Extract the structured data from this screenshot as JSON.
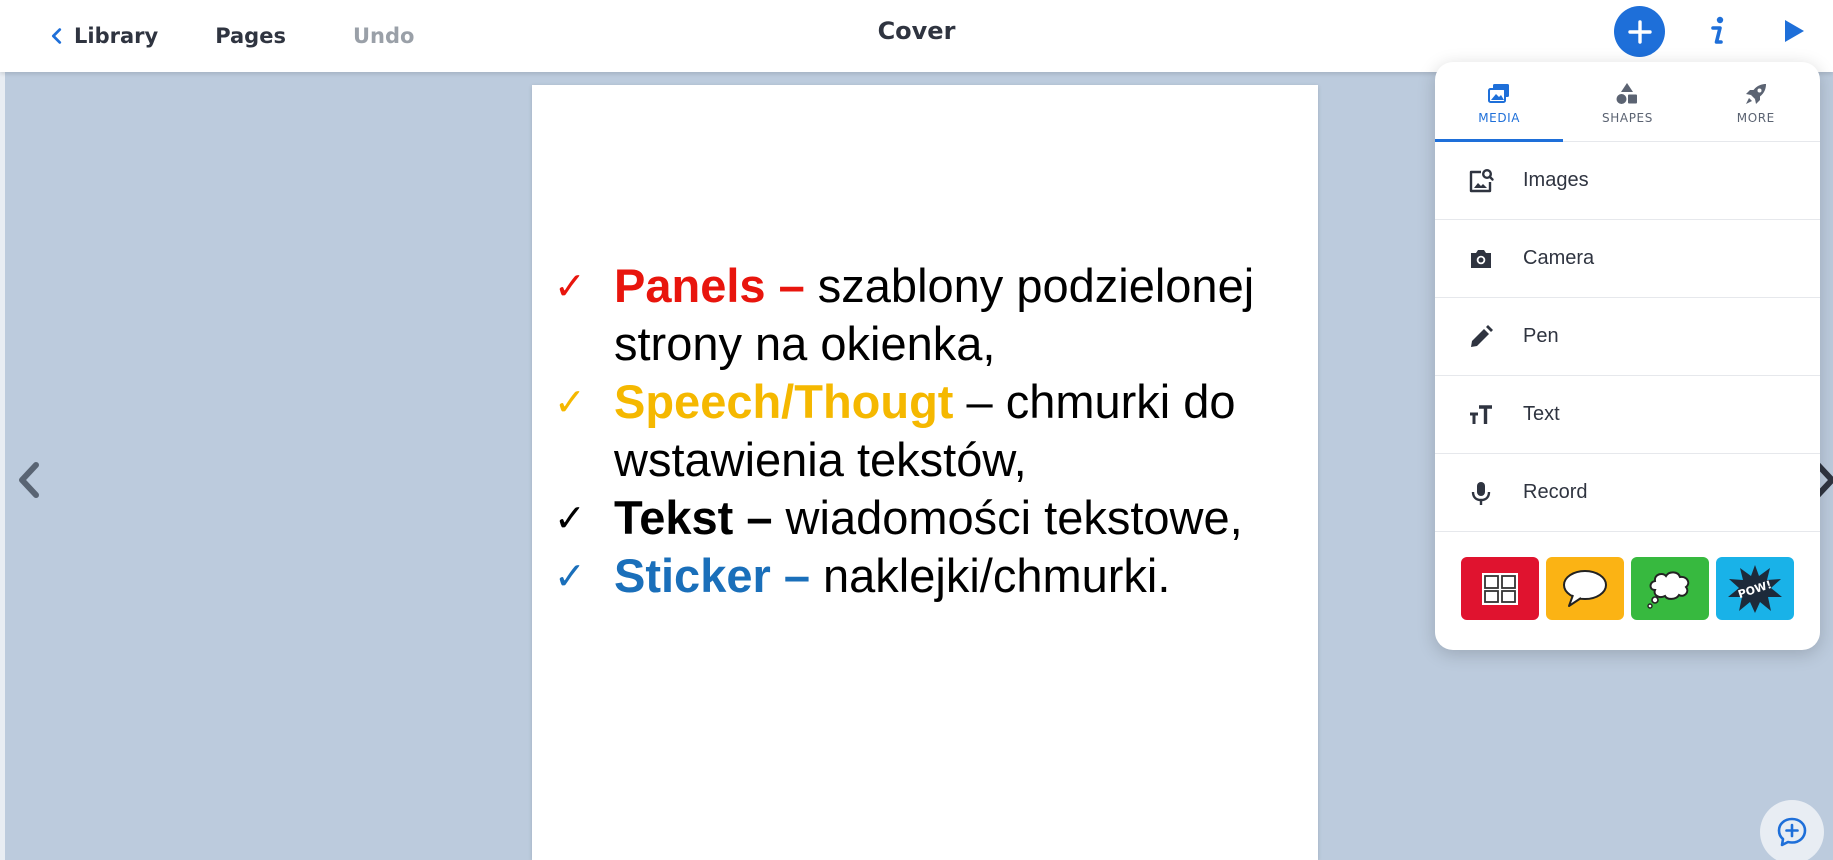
{
  "header": {
    "library_label": "Library",
    "pages_label": "Pages",
    "undo_label": "Undo",
    "title": "Cover",
    "add_icon": "plus-icon",
    "info_icon": "info-icon",
    "play_icon": "play-icon"
  },
  "page": {
    "items": [
      {
        "term": "Panels –",
        "text": " szablony podzielonej strony na okienka,",
        "color": "#e8150d",
        "check": "✓"
      },
      {
        "term": "Speech/Thougt",
        "text": " – chmurki do wstawienia tekstów,",
        "color": "#f5b800",
        "check": "✓"
      },
      {
        "term": "Tekst –",
        "text": " wiadomości tekstowe,",
        "color": "#000000",
        "check": "✓"
      },
      {
        "term": "Sticker –",
        "text": " naklejki/chmurki.",
        "color": "#1a6fba",
        "check": "✓"
      }
    ]
  },
  "panel": {
    "tabs": [
      {
        "label": "MEDIA",
        "icon": "media-icon",
        "active": true
      },
      {
        "label": "SHAPES",
        "icon": "shapes-icon",
        "active": false
      },
      {
        "label": "MORE",
        "icon": "rocket-icon",
        "active": false
      }
    ],
    "menu": [
      {
        "label": "Images",
        "icon": "image-search-icon"
      },
      {
        "label": "Camera",
        "icon": "camera-icon"
      },
      {
        "label": "Pen",
        "icon": "pen-icon"
      },
      {
        "label": "Text",
        "icon": "text-size-icon"
      },
      {
        "label": "Record",
        "icon": "microphone-icon"
      }
    ],
    "tiles": [
      {
        "icon": "panels-grid-icon",
        "color": "#e0132f"
      },
      {
        "icon": "speech-bubble-icon",
        "color": "#fbb314"
      },
      {
        "icon": "thought-bubble-icon",
        "color": "#37b93f"
      },
      {
        "icon": "pow-sticker-icon",
        "color": "#19b2e8",
        "text": "POW!"
      }
    ]
  },
  "colors": {
    "accent": "#1e6fd9",
    "background": "#bccbdd"
  }
}
